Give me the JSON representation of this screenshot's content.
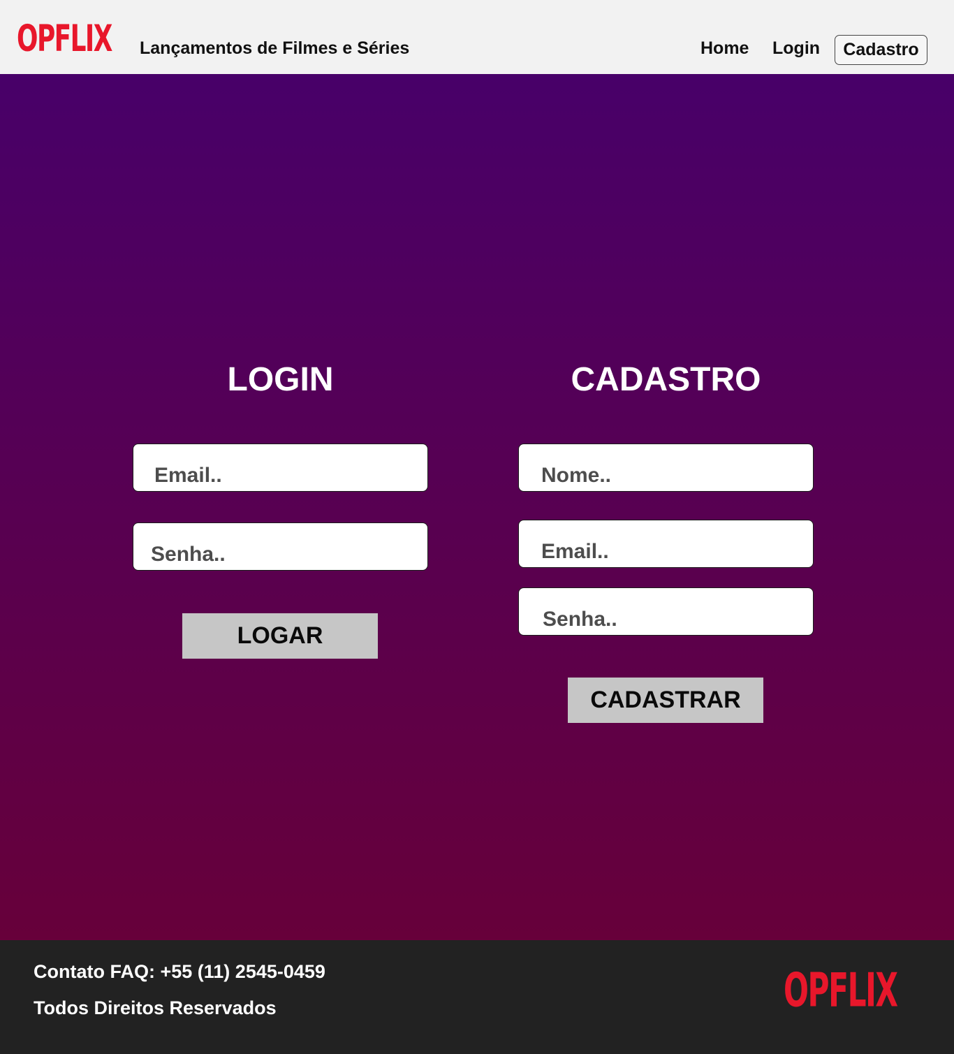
{
  "header": {
    "logo": "OPFLIX",
    "tagline": "Lançamentos de Filmes e Séries",
    "nav": {
      "home": "Home",
      "login": "Login",
      "cadastro": "Cadastro"
    }
  },
  "login": {
    "title": "LOGIN",
    "email_placeholder": "Email..",
    "password_placeholder": "Senha..",
    "button": "LOGAR"
  },
  "cadastro": {
    "title": "CADASTRO",
    "name_placeholder": "Nome..",
    "email_placeholder": "Email..",
    "password_placeholder": "Senha..",
    "button": "CADASTRAR"
  },
  "footer": {
    "contact": "Contato FAQ: +55 (11) 2545-0459",
    "rights": "Todos Direitos Reservados",
    "logo": "OPFLIX"
  },
  "colors": {
    "brand": "#e8172b",
    "gradient_top": "#480069",
    "gradient_bottom": "#67003a",
    "footer_bg": "#222222",
    "button_bg": "#c6c6c6"
  }
}
